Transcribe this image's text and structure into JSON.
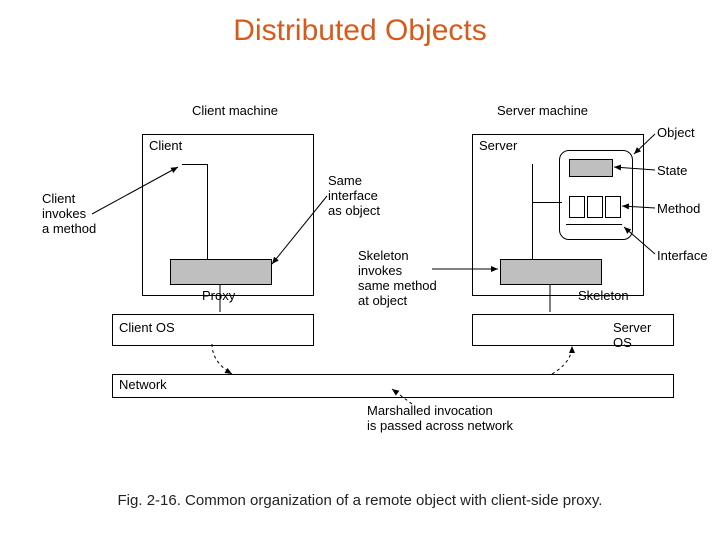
{
  "title": "Distributed Objects",
  "caption": "Fig. 2-16. Common organization of a remote object with client-side proxy.",
  "diagram": {
    "client_machine": "Client machine",
    "server_machine": "Server machine",
    "client": "Client",
    "server": "Server",
    "object": "Object",
    "state": "State",
    "method": "Method",
    "interface_lbl": "Interface",
    "client_invokes": "Client\ninvokes\na method",
    "same_interface": "Same\ninterface\nas object",
    "proxy": "Proxy",
    "skeleton": "Skeleton",
    "skeleton_invokes": "Skeleton\ninvokes\nsame method\nat object",
    "client_os": "Client OS",
    "server_os": "Server OS",
    "network": "Network",
    "marshalled": "Marshalled invocation\nis passed across network"
  }
}
